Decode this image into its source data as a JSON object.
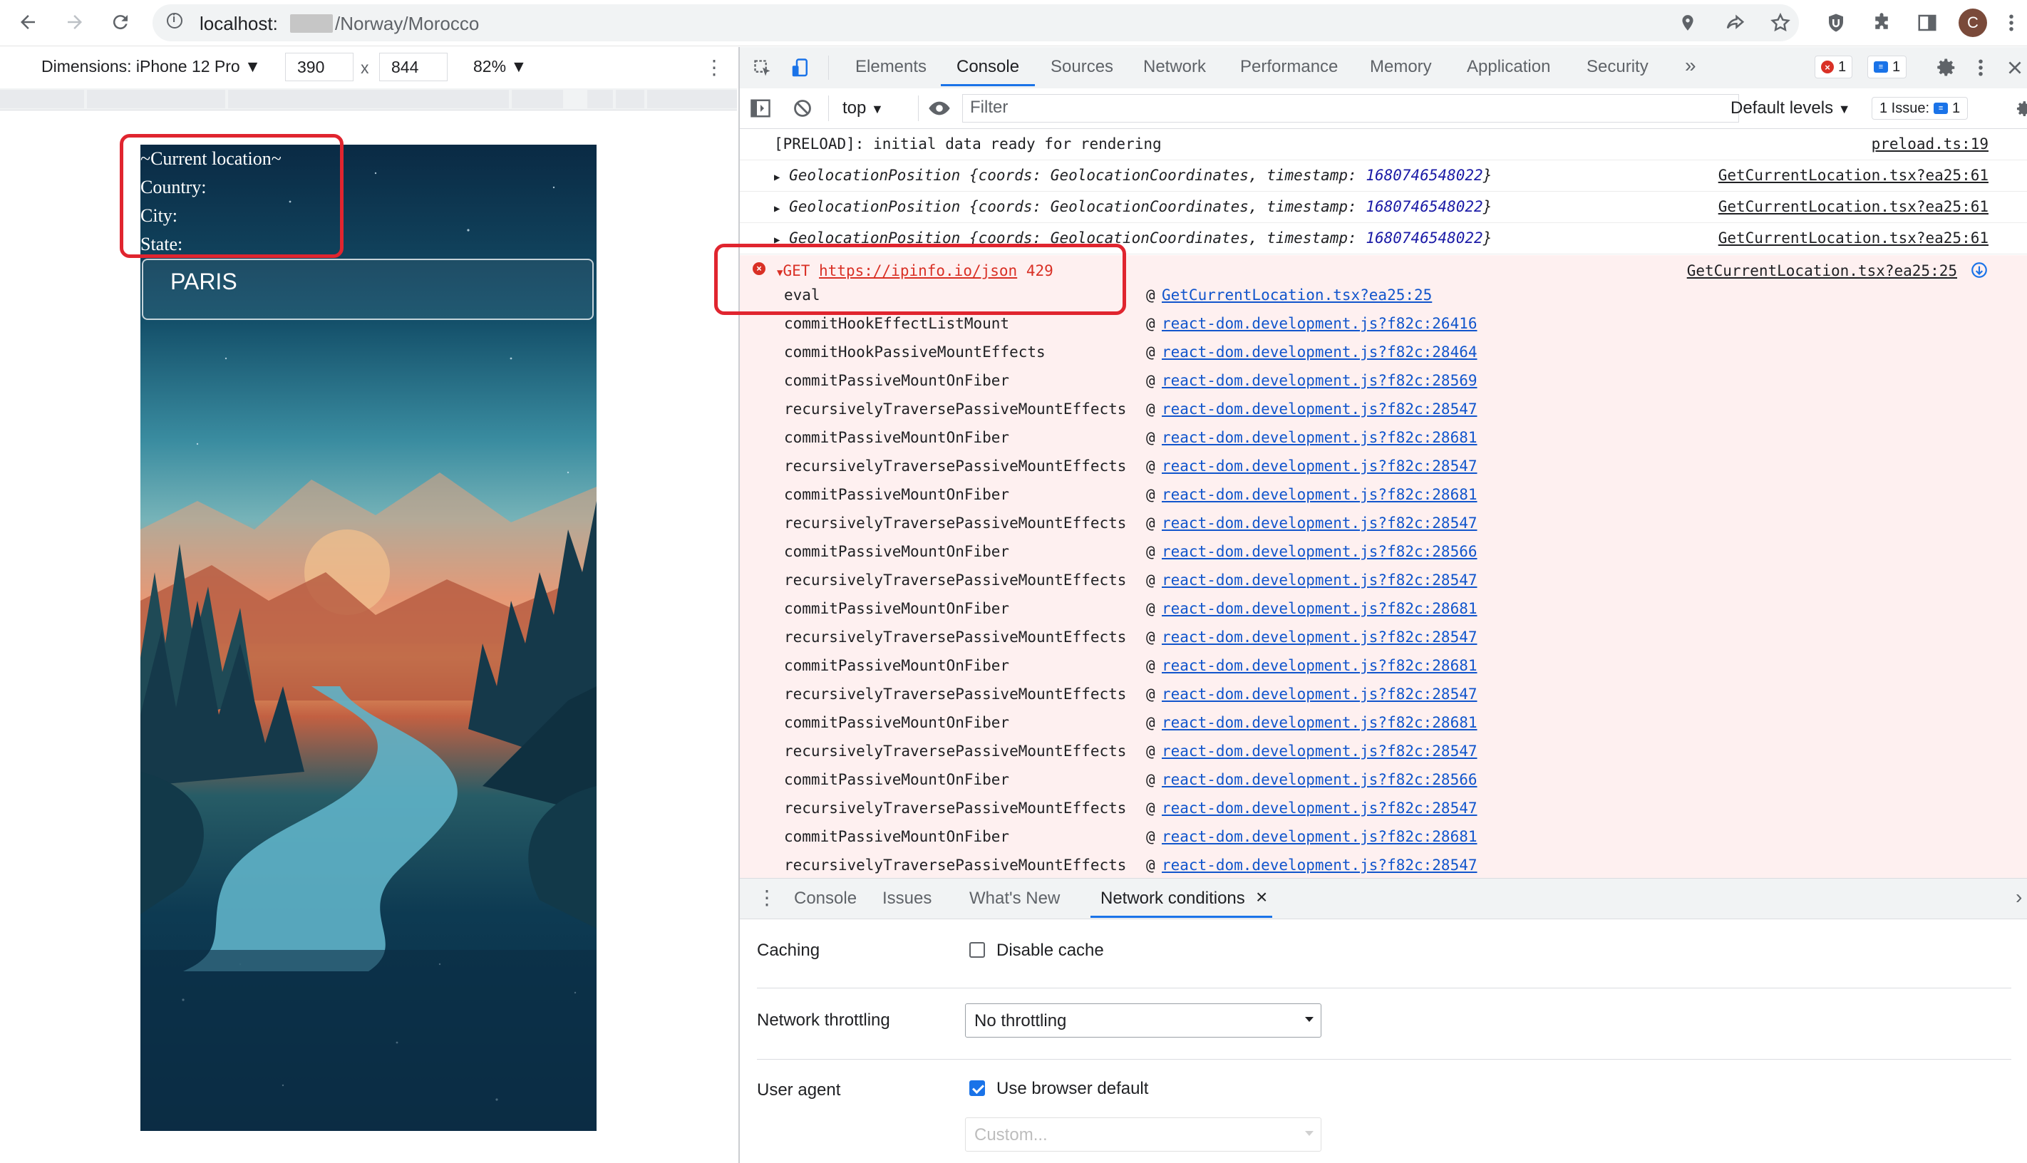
{
  "browser": {
    "url_host": "localhost:",
    "url_path": "/Norway/Morocco",
    "avatar_letter": "C"
  },
  "device_toolbar": {
    "dimensions_label": "Dimensions: iPhone 12 Pro",
    "width": "390",
    "height": "844",
    "times": "x",
    "zoom": "82%"
  },
  "mobile_page": {
    "lines": [
      "~Current location~",
      "Country:",
      "City:",
      "State:"
    ],
    "search_value": "PARIS"
  },
  "devtools": {
    "tabs": [
      "Elements",
      "Console",
      "Sources",
      "Network",
      "Performance",
      "Memory",
      "Application",
      "Security"
    ],
    "more_tabs": "»",
    "error_count": "1",
    "message_count": "1",
    "context": "top",
    "filter_placeholder": "Filter",
    "levels": "Default levels",
    "issues_label": "1 Issue:",
    "issues_count": "1"
  },
  "console": {
    "preload": {
      "text": "[PRELOAD]: initial data ready for rendering",
      "source": "preload.ts:19"
    },
    "geo_lines": [
      {
        "label": "GeolocationPosition",
        "source": "GetCurrentLocation.tsx?ea25:61"
      },
      {
        "label": "GeolocationPosition",
        "source": "GetCurrentLocation.tsx?ea25:61"
      },
      {
        "label": "GeolocationPosition",
        "source": "GetCurrentLocation.tsx?ea25:61"
      }
    ],
    "geo_detail": {
      "open": "{",
      "coords_key": "coords:",
      "coords_val": "GeolocationCoordinates,",
      "ts_key": "timestamp:",
      "ts_val": "1680746548022",
      "close": "}"
    },
    "error": {
      "method": "GET",
      "url": "https://ipinfo.io/json",
      "status": "429",
      "source": "GetCurrentLocation.tsx?ea25:25"
    },
    "stack": [
      {
        "fn": "eval",
        "link": "GetCurrentLocation.tsx?ea25:25"
      },
      {
        "fn": "commitHookEffectListMount",
        "link": "react-dom.development.js?f82c:26416"
      },
      {
        "fn": "commitHookPassiveMountEffects",
        "link": "react-dom.development.js?f82c:28464"
      },
      {
        "fn": "commitPassiveMountOnFiber",
        "link": "react-dom.development.js?f82c:28569"
      },
      {
        "fn": "recursivelyTraversePassiveMountEffects",
        "link": "react-dom.development.js?f82c:28547"
      },
      {
        "fn": "commitPassiveMountOnFiber",
        "link": "react-dom.development.js?f82c:28681"
      },
      {
        "fn": "recursivelyTraversePassiveMountEffects",
        "link": "react-dom.development.js?f82c:28547"
      },
      {
        "fn": "commitPassiveMountOnFiber",
        "link": "react-dom.development.js?f82c:28681"
      },
      {
        "fn": "recursivelyTraversePassiveMountEffects",
        "link": "react-dom.development.js?f82c:28547"
      },
      {
        "fn": "commitPassiveMountOnFiber",
        "link": "react-dom.development.js?f82c:28566"
      },
      {
        "fn": "recursivelyTraversePassiveMountEffects",
        "link": "react-dom.development.js?f82c:28547"
      },
      {
        "fn": "commitPassiveMountOnFiber",
        "link": "react-dom.development.js?f82c:28681"
      },
      {
        "fn": "recursivelyTraversePassiveMountEffects",
        "link": "react-dom.development.js?f82c:28547"
      },
      {
        "fn": "commitPassiveMountOnFiber",
        "link": "react-dom.development.js?f82c:28681"
      },
      {
        "fn": "recursivelyTraversePassiveMountEffects",
        "link": "react-dom.development.js?f82c:28547"
      },
      {
        "fn": "commitPassiveMountOnFiber",
        "link": "react-dom.development.js?f82c:28681"
      },
      {
        "fn": "recursivelyTraversePassiveMountEffects",
        "link": "react-dom.development.js?f82c:28547"
      },
      {
        "fn": "commitPassiveMountOnFiber",
        "link": "react-dom.development.js?f82c:28566"
      },
      {
        "fn": "recursivelyTraversePassiveMountEffects",
        "link": "react-dom.development.js?f82c:28547"
      },
      {
        "fn": "commitPassiveMountOnFiber",
        "link": "react-dom.development.js?f82c:28681"
      },
      {
        "fn": "recursivelyTraversePassiveMountEffects",
        "link": "react-dom.development.js?f82c:28547"
      }
    ]
  },
  "drawer": {
    "tabs": [
      "Console",
      "Issues",
      "What's New",
      "Network conditions"
    ],
    "close": "×"
  },
  "network_conditions": {
    "caching_label": "Caching",
    "disable_cache_label": "Disable cache",
    "disable_cache_checked": false,
    "throttling_label": "Network throttling",
    "throttling_value": "No throttling",
    "user_agent_label": "User agent",
    "use_default_label": "Use browser default",
    "use_default_checked": true,
    "custom_placeholder": "Custom..."
  },
  "colors": {
    "highlight_box": "#e0252f",
    "accent": "#1a73e8",
    "error": "#d93025",
    "link": "#1155cc"
  }
}
